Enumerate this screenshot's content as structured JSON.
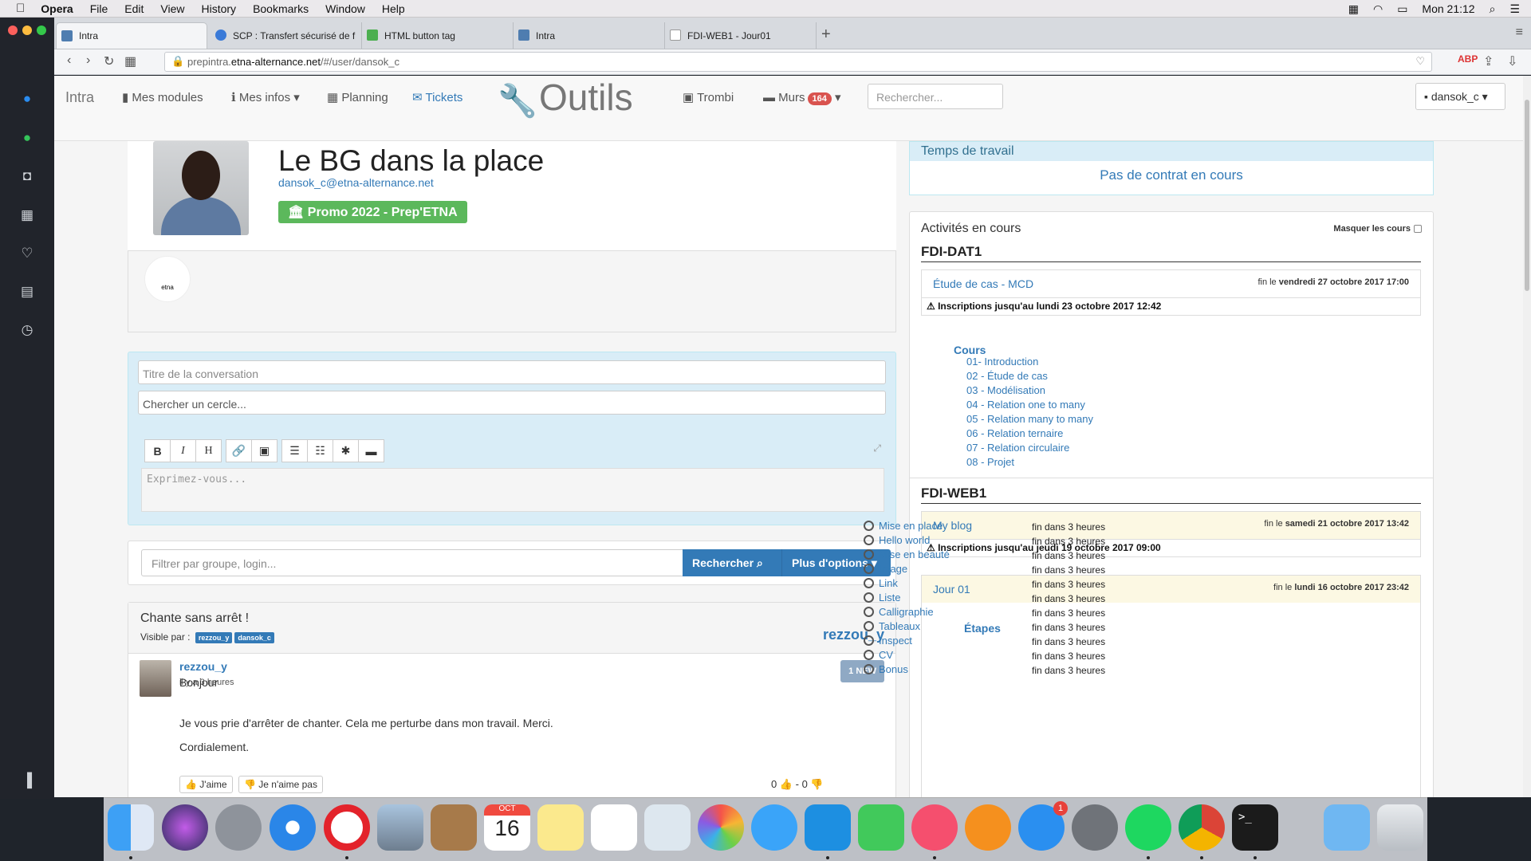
{
  "menubar": {
    "app": "Opera",
    "items": [
      "File",
      "Edit",
      "View",
      "History",
      "Bookmarks",
      "Window",
      "Help"
    ],
    "clock": "Mon 21:12"
  },
  "tabs": [
    {
      "label": "Intra"
    },
    {
      "label": "SCP : Transfert sécurisé de f"
    },
    {
      "label": "HTML button tag"
    },
    {
      "label": "Intra"
    },
    {
      "label": "FDI-WEB1 - Jour01"
    }
  ],
  "address": {
    "prefix": "prepintra.",
    "domain": "etna-alternance.net",
    "path": "/#/user/dansok_c"
  },
  "nav": {
    "brand": "Intra",
    "modules": "Mes modules",
    "infos": "Mes infos",
    "planning": "Planning",
    "tickets": "Tickets",
    "outils": "Outils",
    "trombi": "Trombi",
    "murs": "Murs",
    "murs_count": "164",
    "search_placeholder": "Rechercher...",
    "user": "dansok_c"
  },
  "profile": {
    "name": "Le BG dans la place",
    "email": "dansok_c@etna-alternance.net",
    "promo": "Promo 2022 - Prep'ETNA"
  },
  "composer": {
    "title_placeholder": "Titre de la conversation",
    "circle_placeholder": "Chercher un cercle...",
    "editor_placeholder": "Exprimez-vous...",
    "tools": [
      "B",
      "I",
      "H",
      "🔗",
      "▣",
      "☰",
      "☷",
      "✱",
      "▬"
    ]
  },
  "filter": {
    "placeholder": "Filtrer par groupe, login...",
    "search_btn": "Rechercher",
    "more_btn": "Plus d'options"
  },
  "post": {
    "title": "Chante sans arrêt !",
    "visible_label": "Visible par :",
    "visible_to": [
      "rezzou_y",
      "dansok_c"
    ],
    "owner": "rezzou_y",
    "author": "rezzou_y",
    "time": "il y a 3 heures",
    "new_badge": "1 NEW",
    "lines": [
      "Bonjour",
      "Je vous prie d'arrêter de chanter. Cela me perturbe dans mon travail. Merci.",
      "Cordialement."
    ],
    "like": "J'aime",
    "dislike": "Je n'aime pas",
    "votes": "0 👍 - 0 👎"
  },
  "work": {
    "title": "Temps de travail",
    "status": "Pas de contrat en cours"
  },
  "activities": {
    "title": "Activités en cours",
    "mask": "Masquer les cours",
    "sections": [
      {
        "name": "FDI-DAT1",
        "activity": "Étude de cas - MCD",
        "due_prefix": "fin le",
        "due": "vendredi 27 octobre 2017 17:00",
        "inscriptions": "Inscriptions jusqu'au lundi 23 octobre 2017 12:42",
        "sub_title": "Cours",
        "courses": [
          "01- Introduction",
          "02 - Étude de cas",
          "03 - Modélisation",
          "04 - Relation one to many",
          "05 - Relation many to many",
          "06 - Relation ternaire",
          "07 - Relation circulaire",
          "08 - Projet"
        ]
      },
      {
        "name": "FDI-WEB1",
        "activity": "My blog",
        "due_prefix": "fin le",
        "due": "samedi 21 octobre 2017 13:42",
        "inscriptions": "Inscriptions jusqu'au jeudi 19 octobre 2017 09:00",
        "activity2": "Jour 01",
        "due2": "lundi 16 octobre 2017 23:42",
        "sub_title": "Étapes",
        "steps": [
          "Mise en place",
          "Hello world",
          "Mise en beauté",
          "Image",
          "Link",
          "Liste",
          "Calligraphie",
          "Tableaux",
          "Inspect",
          "CV",
          "Bonus"
        ],
        "step_due": "fin dans 3 heures"
      }
    ]
  },
  "dock": {
    "calendar_month": "OCT",
    "calendar_day": "16",
    "appstore_badge": "1"
  }
}
